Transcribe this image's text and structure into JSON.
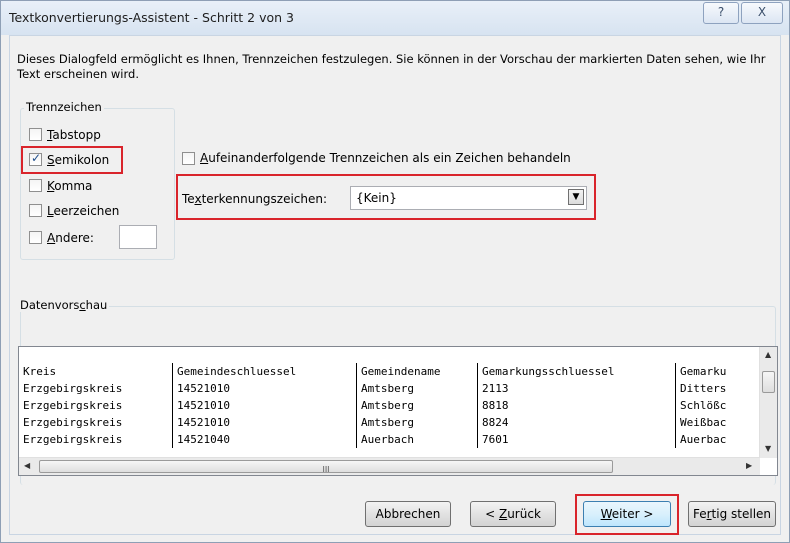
{
  "window": {
    "title": "Textkonvertierungs-Assistent - Schritt 2 von 3",
    "help_label": "?",
    "close_label": "X"
  },
  "description": "Dieses Dialogfeld ermöglicht es Ihnen, Trennzeichen festzulegen. Sie können in der Vorschau der markierten Daten sehen, wie Ihr Text erscheinen wird.",
  "delimiters": {
    "legend": "Trennzeichen",
    "options": [
      {
        "label_key": "T",
        "label_rest": "abstopp",
        "checked": false
      },
      {
        "label_key": "S",
        "label_rest": "emikolon",
        "checked": true
      },
      {
        "label_key": "K",
        "label_rest": "omma",
        "checked": false
      },
      {
        "label_key": "L",
        "label_rest": "eerzeichen",
        "checked": false
      },
      {
        "label_key": "A",
        "label_rest": "ndere:",
        "checked": false
      }
    ],
    "other_value": ""
  },
  "consecutive": {
    "label_key": "A",
    "label_rest": "ufeinanderfolgende Trennzeichen als ein Zeichen behandeln",
    "checked": false
  },
  "text_qualifier": {
    "label_pre": "Te",
    "label_key": "x",
    "label_rest": "terkennungszeichen:",
    "value": "{Kein}"
  },
  "preview": {
    "legend_pre": "Datenvors",
    "legend_key": "c",
    "legend_rest": "hau",
    "header": [
      "Kreis",
      "Gemeindeschluessel",
      "Gemeindename",
      "Gemarkungsschluessel",
      "Gemarku"
    ],
    "rows": [
      [
        "Erzgebirgskreis",
        "14521010",
        "Amtsberg",
        "2113",
        "Ditters"
      ],
      [
        "Erzgebirgskreis",
        "14521010",
        "Amtsberg",
        "8818",
        "Schlößc"
      ],
      [
        "Erzgebirgskreis",
        "14521010",
        "Amtsberg",
        "8824",
        "Weißbac"
      ],
      [
        "Erzgebirgskreis",
        "14521040",
        "Auerbach",
        "7601",
        "Auerbac"
      ]
    ],
    "scroll_grip": "III"
  },
  "buttons": {
    "cancel": "Abbrechen",
    "back_pre": "< ",
    "back_key": "Z",
    "back_rest": "urück",
    "next_key": "W",
    "next_rest": "eiter >",
    "finish_pre": "Fe",
    "finish_key": "r",
    "finish_rest": "tig stellen"
  },
  "colors": {
    "highlight": "#d9242b",
    "title_bar": "#dbe6f3",
    "dialog_bg": "#f0f0f0"
  }
}
